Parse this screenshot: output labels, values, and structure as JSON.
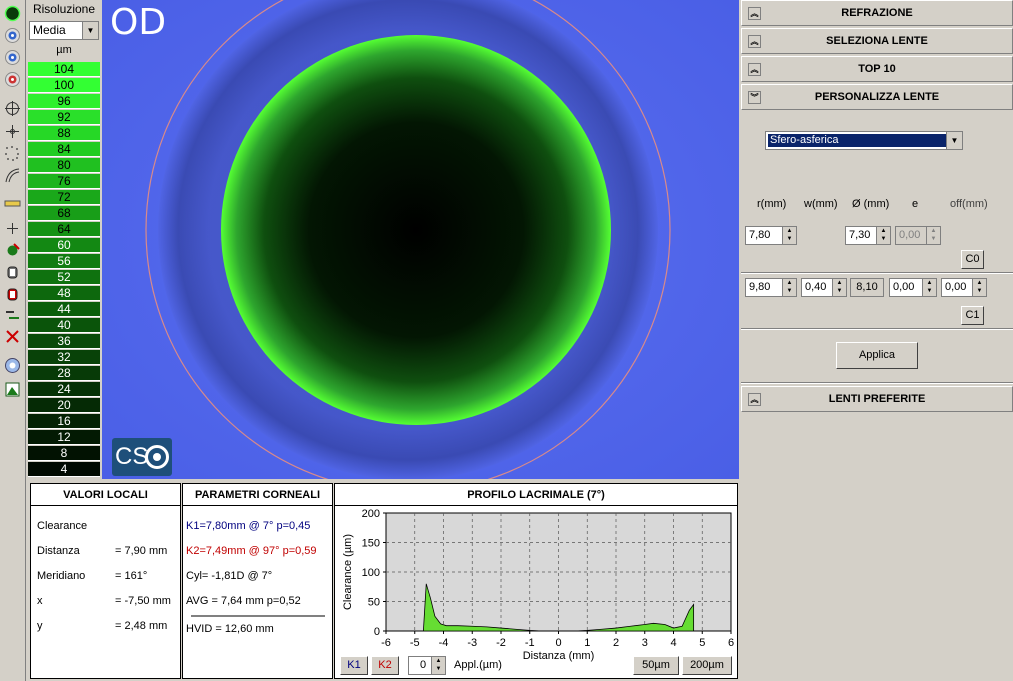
{
  "scale": {
    "resolution_label": "Risoluzione",
    "resolution_value": "Media",
    "unit": "µm",
    "bands": [
      {
        "v": "104",
        "c": "#33ff33"
      },
      {
        "v": "100",
        "c": "#33ff33"
      },
      {
        "v": "96",
        "c": "#2ef02e"
      },
      {
        "v": "92",
        "c": "#2ae02a"
      },
      {
        "v": "88",
        "c": "#26d826"
      },
      {
        "v": "84",
        "c": "#22cc22"
      },
      {
        "v": "80",
        "c": "#20c020"
      },
      {
        "v": "76",
        "c": "#1db41d"
      },
      {
        "v": "72",
        "c": "#1aa81a"
      },
      {
        "v": "68",
        "c": "#189e18"
      },
      {
        "v": "64",
        "c": "#159215"
      },
      {
        "v": "60",
        "c": "#138813"
      },
      {
        "v": "56",
        "c": "#117c11"
      },
      {
        "v": "52",
        "c": "#0f720f"
      },
      {
        "v": "48",
        "c": "#0d680d"
      },
      {
        "v": "44",
        "c": "#0b5e0b"
      },
      {
        "v": "40",
        "c": "#0a540a"
      },
      {
        "v": "36",
        "c": "#094a09"
      },
      {
        "v": "32",
        "c": "#084208"
      },
      {
        "v": "28",
        "c": "#073a07"
      },
      {
        "v": "24",
        "c": "#063206"
      },
      {
        "v": "20",
        "c": "#052a05"
      },
      {
        "v": "16",
        "c": "#042204"
      },
      {
        "v": "12",
        "c": "#031a03"
      },
      {
        "v": "8",
        "c": "#021202"
      },
      {
        "v": "4",
        "c": "#010a01"
      }
    ]
  },
  "image": {
    "eye_label": "OD",
    "logo_text": "CS"
  },
  "toolbar": {
    "icons": [
      "green-dot-icon",
      "eye-icon-1",
      "eye-icon-2",
      "eye-icon-3",
      "crosshair-icon",
      "move-icon",
      "dots-icon",
      "arc-icon",
      "ruler-icon",
      "center-icon",
      "green-marker-icon",
      "hand-icon",
      "hand-red-icon",
      "tilt-icon",
      "delete-icon",
      "lens-icon",
      "diagram-icon"
    ]
  },
  "right_panel": {
    "sections": {
      "refrazione": "REFRAZIONE",
      "seleziona": "SELEZIONA LENTE",
      "top10": "TOP 10",
      "personalizza": "PERSONALIZZA LENTE",
      "preferite": "LENTI PREFERITE"
    },
    "lens_type": "Sfero-asferica",
    "col_labels": {
      "r": "r(mm)",
      "w": "w(mm)",
      "d": "Ø (mm)",
      "e": "e",
      "off": "off(mm)"
    },
    "c0": {
      "r": "7,80",
      "d": "7,30",
      "e": "0,00",
      "label": "C0"
    },
    "c1": {
      "r": "9,80",
      "w": "0,40",
      "d": "8,10",
      "e": "0,00",
      "off": "0,00",
      "label": "C1"
    },
    "apply_label": "Applica"
  },
  "valori_locali": {
    "title": "VALORI LOCALI",
    "rows": [
      {
        "k": "Clearance",
        "v": ""
      },
      {
        "k": "Distanza",
        "v": "= 7,90 mm"
      },
      {
        "k": "Meridiano",
        "v": "= 161°"
      },
      {
        "k": "x",
        "v": "= -7,50 mm"
      },
      {
        "k": "y",
        "v": "= 2,48 mm"
      }
    ]
  },
  "parametri": {
    "title": "PARAMETRI CORNEALI",
    "k1": "K1=7,80mm @ 7° p=0,45",
    "k2": "K2=7,49mm @ 97° p=0,59",
    "cyl": "Cyl= -1,81D   @ 7°",
    "avg": "AVG = 7,64 mm   p=0,52",
    "hvid": "HVID = 12,60 mm",
    "colors": {
      "k1": "#00007f",
      "k2": "#c00000"
    }
  },
  "profilo": {
    "title": "PROFILO LACRIMALE (7°)",
    "k1_btn": "K1",
    "k2_btn": "K2",
    "appl_value": "0",
    "appl_label": "Appl.(µm)",
    "btn_50": "50µm",
    "btn_200": "200µm"
  },
  "chart_data": {
    "type": "area",
    "title": "PROFILO LACRIMALE (7°)",
    "xlabel": "Distanza (mm)",
    "ylabel": "Clearance (µm)",
    "xlim": [
      -6,
      6
    ],
    "ylim": [
      0,
      200
    ],
    "xticks": [
      -6,
      -5,
      -4,
      -3,
      -2,
      -1,
      0,
      1,
      2,
      3,
      4,
      5,
      6
    ],
    "yticks": [
      0,
      50,
      100,
      150,
      200
    ],
    "grid": true,
    "x": [
      -4.7,
      -4.6,
      -4.45,
      -4.3,
      -4.1,
      -3.9,
      -3.5,
      -3.0,
      -2.5,
      -2.0,
      -1.5,
      -1.0,
      -0.6,
      0,
      0.6,
      1.0,
      1.5,
      2.0,
      2.5,
      3.0,
      3.3,
      3.7,
      4.0,
      4.3,
      4.55,
      4.7
    ],
    "y": [
      0,
      80,
      55,
      25,
      12,
      9,
      9,
      8,
      7,
      5,
      3,
      1,
      0,
      0,
      0,
      1,
      3,
      5,
      8,
      11,
      13,
      11,
      5,
      8,
      35,
      45
    ],
    "fill": "#66dd33"
  }
}
